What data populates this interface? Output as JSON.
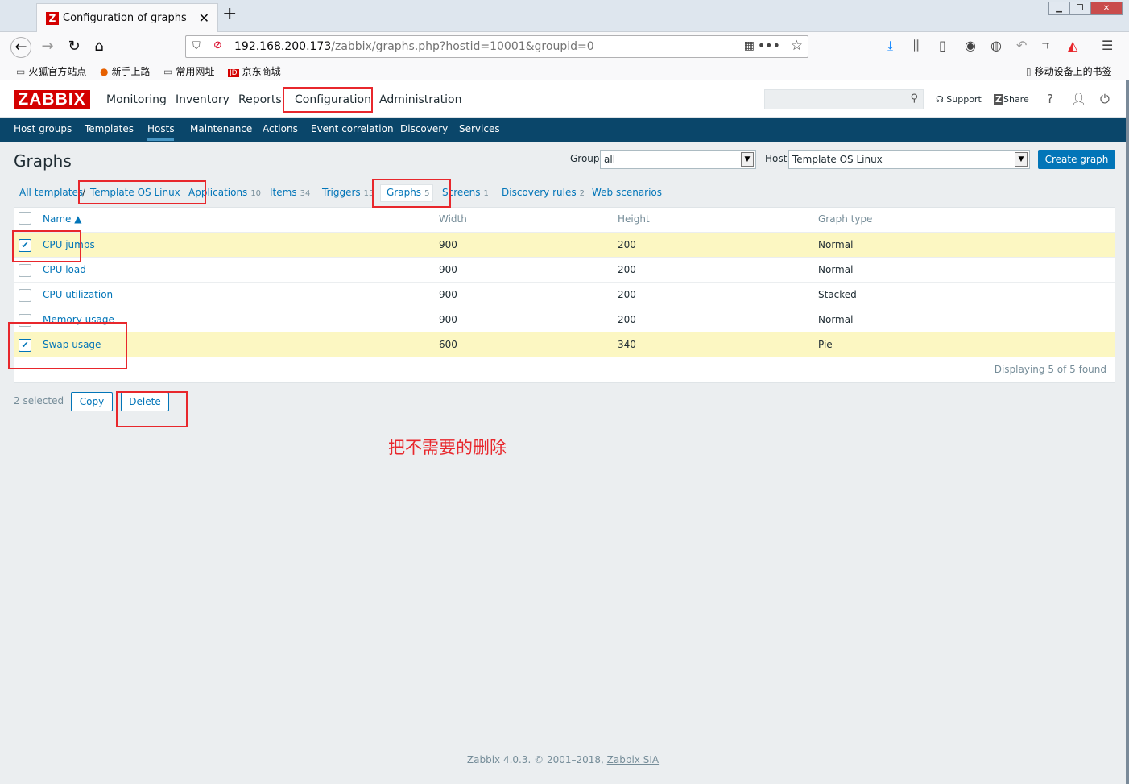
{
  "browser": {
    "tab_title": "Configuration of graphs",
    "tab_favicon": "Z",
    "url_host": "192.168.200.173",
    "url_path": "/zabbix/graphs.php?hostid=10001&groupid=0",
    "bookmarks": [
      "火狐官方站点",
      "新手上路",
      "常用网址",
      "京东商城"
    ],
    "mobile_bookmarks": "移动设备上的书签"
  },
  "header": {
    "logo": "ZABBIX",
    "menu": [
      "Monitoring",
      "Inventory",
      "Reports",
      "Configuration",
      "Administration"
    ],
    "support": "Support",
    "share": "Share",
    "help": "?"
  },
  "submenu": [
    "Host groups",
    "Templates",
    "Hosts",
    "Maintenance",
    "Actions",
    "Event correlation",
    "Discovery",
    "Services"
  ],
  "page": {
    "title": "Graphs",
    "group_label": "Group",
    "group_value": "all",
    "host_label": "Host",
    "host_value": "Template OS Linux",
    "create_button": "Create graph"
  },
  "breadcrumbs": {
    "all_templates": "All templates",
    "separator": "/",
    "template": "Template OS Linux",
    "tabs": [
      {
        "label": "Applications",
        "count": "10"
      },
      {
        "label": "Items",
        "count": "34"
      },
      {
        "label": "Triggers",
        "count": "15"
      },
      {
        "label": "Graphs",
        "count": "5"
      },
      {
        "label": "Screens",
        "count": "1"
      },
      {
        "label": "Discovery rules",
        "count": "2"
      },
      {
        "label": "Web scenarios",
        "count": ""
      }
    ]
  },
  "table": {
    "columns": [
      "Name ▲",
      "Width",
      "Height",
      "Graph type"
    ],
    "rows": [
      {
        "name": "CPU jumps",
        "width": "900",
        "height": "200",
        "type": "Normal",
        "checked": true
      },
      {
        "name": "CPU load",
        "width": "900",
        "height": "200",
        "type": "Normal",
        "checked": false
      },
      {
        "name": "CPU utilization",
        "width": "900",
        "height": "200",
        "type": "Stacked",
        "checked": false
      },
      {
        "name": "Memory usage",
        "width": "900",
        "height": "200",
        "type": "Normal",
        "checked": false
      },
      {
        "name": "Swap usage",
        "width": "600",
        "height": "340",
        "type": "Pie",
        "checked": true
      }
    ],
    "paging": "Displaying 5 of 5 found"
  },
  "actions": {
    "selected": "2 selected",
    "copy": "Copy",
    "delete": "Delete"
  },
  "annotation": "把不需要的删除",
  "footer": {
    "text": "Zabbix 4.0.3. © 2001–2018, ",
    "link": "Zabbix SIA"
  },
  "colors": {
    "brand_red": "#d40000",
    "nav_blue": "#0a466a",
    "link_blue": "#0275b8",
    "selected_row": "#fcf7c2",
    "annotation_red": "#e8272c"
  }
}
